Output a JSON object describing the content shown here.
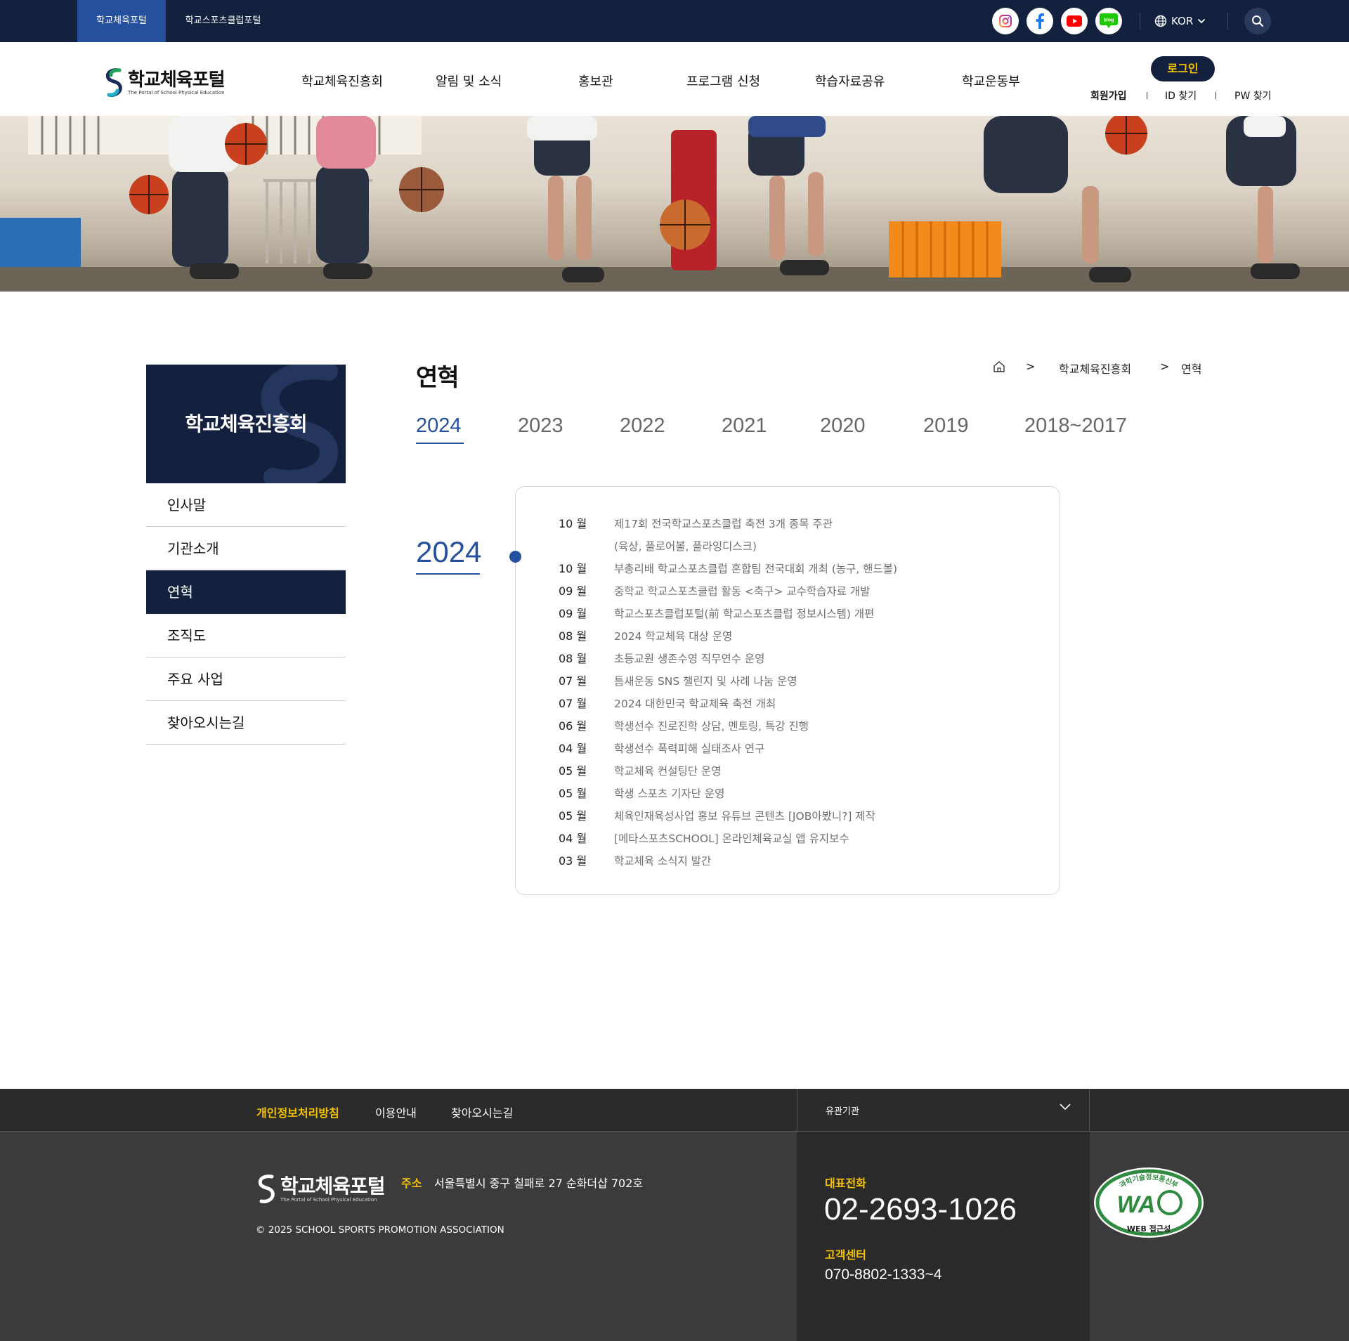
{
  "topbar": {
    "portal_tabs": [
      "학교체육포털",
      "학교스포츠클럽포털"
    ],
    "social": [
      "instagram-icon",
      "facebook-icon",
      "youtube-icon",
      "blog-icon"
    ],
    "social_blog_text": "blog",
    "language": "KOR"
  },
  "header": {
    "logo_title": "학교체육포털",
    "logo_sub": "The Portal of School Physical Education",
    "nav": [
      "학교체육진흥회",
      "알림 및 소식",
      "홍보관",
      "프로그램 신청",
      "학습자료공유",
      "학교운동부"
    ],
    "login": "로그인",
    "util_links": [
      "회원가입",
      "ID 찾기",
      "PW 찾기"
    ]
  },
  "lnb": {
    "title": "학교체육진흥회",
    "items": [
      "인사말",
      "기관소개",
      "연혁",
      "조직도",
      "주요 사업",
      "찾아오시는길"
    ],
    "active_index": 2
  },
  "content": {
    "title": "연혁",
    "breadcrumb": [
      ">",
      "학교체육진흥회",
      ">",
      "연혁"
    ],
    "year_tabs": [
      "2024",
      "2023",
      "2022",
      "2021",
      "2020",
      "2019",
      "2018~2017"
    ],
    "active_year": "2024",
    "events": [
      {
        "month": "10 월",
        "text": "제17회 전국학교스포츠클럽 축전 3개 종목 주관"
      },
      {
        "month": "",
        "text": "(육상, 플로어볼, 플라잉디스크)"
      },
      {
        "month": "10 월",
        "text": "부총리배 학교스포츠클럽 혼합팀 전국대회 개최 (농구, 핸드볼)"
      },
      {
        "month": "09 월",
        "text": "중학교 학교스포츠클럽 활동 <축구> 교수학습자료 개발"
      },
      {
        "month": "09 월",
        "text": "학교스포츠클럽포털(前 학교스포츠클럽 정보시스템) 개편"
      },
      {
        "month": "08 월",
        "text": "2024 학교체육 대상 운영"
      },
      {
        "month": "08 월",
        "text": "초등교원 생존수영 직무연수 운영"
      },
      {
        "month": "07 월",
        "text": "틈새운동 SNS 챌린지 및 사례 나눔 운영"
      },
      {
        "month": "07 월",
        "text": "2024 대한민국 학교체육 축전 개최"
      },
      {
        "month": "06 월",
        "text": "학생선수 진로진학 상담, 멘토링, 특강 진행"
      },
      {
        "month": "04 월",
        "text": "학생선수 폭력피해 실태조사 연구"
      },
      {
        "month": "05 월",
        "text": "학교체육 컨설팅단 운영"
      },
      {
        "month": "05 월",
        "text": "학생 스포츠 기자단 운영"
      },
      {
        "month": "05 월",
        "text": "체육인재육성사업 홍보 유튜브 콘텐츠 [JOB아봤니?] 제작"
      },
      {
        "month": "04 월",
        "text": "[메타스포츠SCHOOL] 온라인체육교실 앱 유지보수"
      },
      {
        "month": "03 월",
        "text": "학교체육 소식지 발간"
      }
    ]
  },
  "footer": {
    "links": [
      "개인정보처리방침",
      "이용안내",
      "찾아오시는길"
    ],
    "family_site": "유관기관",
    "logo_title": "학교체육포털",
    "logo_sub": "The Portal of School Physical Education",
    "address_label": "주소",
    "address": "서울특별시 중구 칠패로 27 순화더샵 702호",
    "copyright": "© 2025 SCHOOL SPORTS PROMOTION ASSOCIATION",
    "main_phone_label": "대표전화",
    "main_phone": "02-2693-1026",
    "cs_label": "고객센터",
    "cs_phone": "070-8802-1333~4",
    "wa_mark": "WA",
    "wa_arc_text": "과학기술정보통신부",
    "wa_sub": "WEB 접근성"
  },
  "colors": {
    "navy": "#13213f",
    "blue": "#25509e",
    "yellow": "#f5c400",
    "footer_dark": "#2a2a2a",
    "footer": "#3b3b3b"
  }
}
